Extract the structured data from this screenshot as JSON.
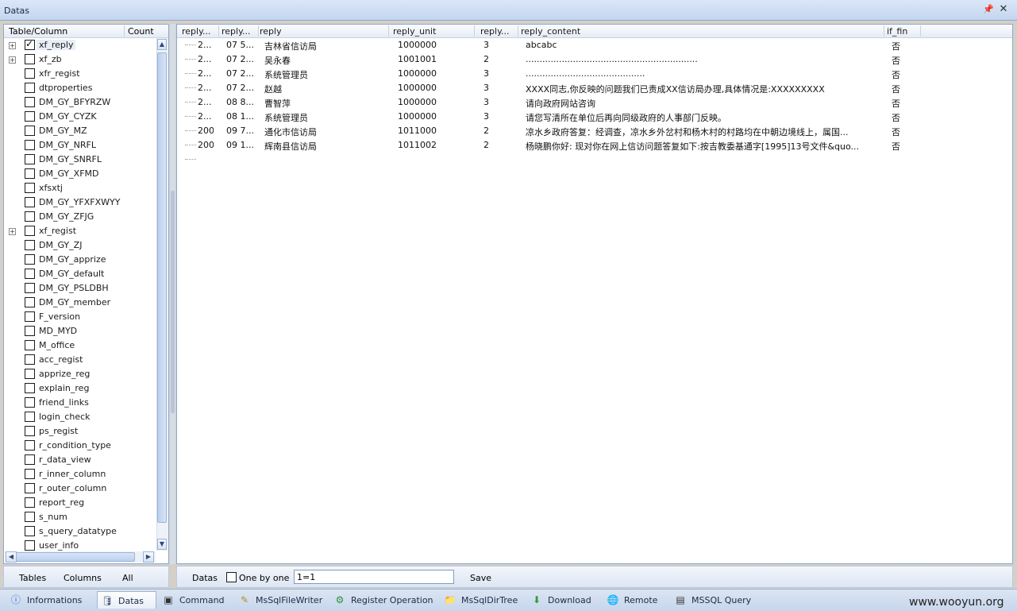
{
  "window": {
    "title": "Datas"
  },
  "left_panel": {
    "columns": [
      "Table/Column",
      "Count"
    ],
    "tables": [
      {
        "name": "xf_reply",
        "checked": true,
        "expandable": true,
        "selected": true
      },
      {
        "name": "xf_zb",
        "checked": false,
        "expandable": true
      },
      {
        "name": "xfr_regist",
        "checked": false,
        "expandable": false
      },
      {
        "name": "dtproperties",
        "checked": false,
        "expandable": false
      },
      {
        "name": "DM_GY_BFYRZW",
        "checked": false,
        "expandable": false
      },
      {
        "name": "DM_GY_CYZK",
        "checked": false,
        "expandable": false
      },
      {
        "name": "DM_GY_MZ",
        "checked": false,
        "expandable": false
      },
      {
        "name": "DM_GY_NRFL",
        "checked": false,
        "expandable": false
      },
      {
        "name": "DM_GY_SNRFL",
        "checked": false,
        "expandable": false
      },
      {
        "name": "DM_GY_XFMD",
        "checked": false,
        "expandable": false
      },
      {
        "name": "xfsxtj",
        "checked": false,
        "expandable": false
      },
      {
        "name": "DM_GY_YFXFXWYY",
        "checked": false,
        "expandable": false
      },
      {
        "name": "DM_GY_ZFJG",
        "checked": false,
        "expandable": false
      },
      {
        "name": "xf_regist",
        "checked": false,
        "expandable": true
      },
      {
        "name": "DM_GY_ZJ",
        "checked": false,
        "expandable": false
      },
      {
        "name": "DM_GY_apprize",
        "checked": false,
        "expandable": false
      },
      {
        "name": "DM_GY_default",
        "checked": false,
        "expandable": false
      },
      {
        "name": "DM_GY_PSLDBH",
        "checked": false,
        "expandable": false
      },
      {
        "name": "DM_GY_member",
        "checked": false,
        "expandable": false
      },
      {
        "name": "F_version",
        "checked": false,
        "expandable": false
      },
      {
        "name": "MD_MYD",
        "checked": false,
        "expandable": false
      },
      {
        "name": "M_office",
        "checked": false,
        "expandable": false
      },
      {
        "name": "acc_regist",
        "checked": false,
        "expandable": false
      },
      {
        "name": "apprize_reg",
        "checked": false,
        "expandable": false
      },
      {
        "name": "explain_reg",
        "checked": false,
        "expandable": false
      },
      {
        "name": "friend_links",
        "checked": false,
        "expandable": false
      },
      {
        "name": "login_check",
        "checked": false,
        "expandable": false
      },
      {
        "name": "ps_regist",
        "checked": false,
        "expandable": false
      },
      {
        "name": "r_condition_type",
        "checked": false,
        "expandable": false
      },
      {
        "name": "r_data_view",
        "checked": false,
        "expandable": false
      },
      {
        "name": "r_inner_column",
        "checked": false,
        "expandable": false
      },
      {
        "name": "r_outer_column",
        "checked": false,
        "expandable": false
      },
      {
        "name": "report_reg",
        "checked": false,
        "expandable": false
      },
      {
        "name": "s_num",
        "checked": false,
        "expandable": false
      },
      {
        "name": "s_query_datatype",
        "checked": false,
        "expandable": false
      },
      {
        "name": "user_info",
        "checked": false,
        "expandable": false
      }
    ],
    "bottom_tabs": [
      "Tables",
      "Columns",
      "All"
    ]
  },
  "grid": {
    "columns": [
      "reply...",
      "reply...",
      "reply",
      "reply_unit",
      "reply...",
      "reply_content",
      "if_fin"
    ],
    "rows": [
      [
        "2...",
        "07 5...",
        "吉林省信访局",
        "1000000",
        "3",
        "abcabc",
        "否"
      ],
      [
        "2...",
        "07 2...",
        "吴永春",
        "1001001",
        "2",
        "..............................................................",
        "否"
      ],
      [
        "2...",
        "07 2...",
        "系统管理员",
        "1000000",
        "3",
        "...........................................",
        "否"
      ],
      [
        "2...",
        "07 2...",
        "赵越",
        "1000000",
        "3",
        "XXXX同志,你反映的问题我们已责成XX信访局办理,具体情况是:XXXXXXXXX",
        "否"
      ],
      [
        "2...",
        "08 8...",
        "曹智萍",
        "1000000",
        "3",
        "请向政府网站咨询",
        "否"
      ],
      [
        "2...",
        "08 1...",
        "系统管理员",
        "1000000",
        "3",
        "请您写清所在单位后再向同级政府的人事部门反映。",
        "否"
      ],
      [
        "200",
        "09 7...",
        "通化市信访局",
        "1011000",
        "2",
        "凉水乡政府答复：经调查，凉水乡外岔村和杨木村的村路均在中朝边境线上，属国...",
        "否"
      ],
      [
        "200",
        "09 1...",
        "辉南县信访局",
        "1011002",
        "2",
        "杨晓鹏你好:  现对你在网上信访问题答复如下:按吉教委基通字[1995]13号文件&quo...",
        "否"
      ]
    ]
  },
  "grid_toolbar": {
    "datas_label": "Datas",
    "one_by_one_label": "One by one",
    "condition_value": "1=1",
    "save_label": "Save"
  },
  "tabs": [
    {
      "label": "Informations",
      "icon": "info-icon"
    },
    {
      "label": "Datas",
      "icon": "database-icon",
      "active": true
    },
    {
      "label": "Command",
      "icon": "terminal-icon"
    },
    {
      "label": "MsSqlFileWriter",
      "icon": "pencil-icon"
    },
    {
      "label": "Register Operation",
      "icon": "registry-icon"
    },
    {
      "label": "MsSqlDirTree",
      "icon": "folder-icon"
    },
    {
      "label": "Download",
      "icon": "download-icon"
    },
    {
      "label": "Remote",
      "icon": "globe-icon"
    },
    {
      "label": "MSSQL Query",
      "icon": "sql-icon"
    }
  ],
  "watermark": "www.wooyun.org"
}
